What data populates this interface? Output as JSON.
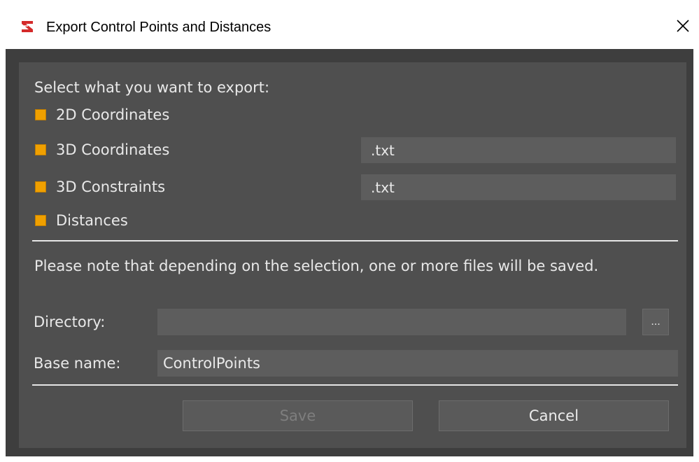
{
  "window": {
    "title": "Export Control Points and Distances"
  },
  "colors": {
    "accent": "#f0a000",
    "panel": "#4f4f4f",
    "field": "#5d5d5d",
    "client": "#3e3e3e"
  },
  "export": {
    "prompt": "Select what you want to export:",
    "options": [
      {
        "label": "2D Coordinates",
        "checked": true
      },
      {
        "label": "3D Coordinates",
        "checked": true,
        "extension": ".txt"
      },
      {
        "label": "3D Constraints",
        "checked": true,
        "extension": ".txt"
      },
      {
        "label": "Distances",
        "checked": true
      }
    ]
  },
  "note": "Please note that depending on the selection, one or more files will be saved.",
  "directory": {
    "label": "Directory:",
    "value": "",
    "browse_label": "..."
  },
  "base_name": {
    "label": "Base name:",
    "value": "ControlPoints"
  },
  "buttons": {
    "save": "Save",
    "cancel": "Cancel"
  }
}
